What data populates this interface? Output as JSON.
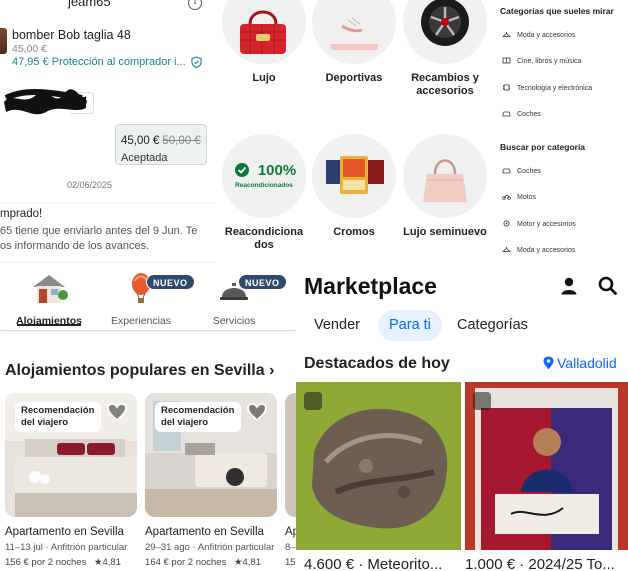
{
  "chat": {
    "username": "jeam65",
    "item_title": "bomber Bob taglia 48",
    "item_price": "45,00 €",
    "protection": "47,95 € Protección al comprador i...",
    "bubble_fragment": "5",
    "offer_new_price": "45,00 €",
    "offer_old_price": "50,00 €",
    "offer_status": "Aceptada",
    "date": "02/06/2025",
    "system_title": "mprado!",
    "system_line1": "65 tiene que enviarlo antes del 9 Jun. Te",
    "system_line2": "os informando de los avances."
  },
  "categories_grid": [
    {
      "label": "Lujo"
    },
    {
      "label": "Deportivas"
    },
    {
      "label": "Recambios y accesorios"
    },
    {
      "label": "Reacondiciona dos",
      "image_text": "100%",
      "image_subtext": "Reacondicionados"
    },
    {
      "label": "Cromos"
    },
    {
      "label": "Lujo seminuevo"
    }
  ],
  "category_list": {
    "usual_heading": "Categorías que sueles mirar",
    "usual_items": [
      {
        "label": "Moda y accesorios",
        "icon": "hanger-icon"
      },
      {
        "label": "Cine, libros y música",
        "icon": "book-icon"
      },
      {
        "label": "Tecnología y electrónica",
        "icon": "chip-icon"
      },
      {
        "label": "Coches",
        "icon": "car-icon"
      }
    ],
    "search_heading": "Buscar por categoría",
    "search_items": [
      {
        "label": "Coches",
        "icon": "car-icon"
      },
      {
        "label": "Motos",
        "icon": "motorbike-icon"
      },
      {
        "label": "Motor y accesorios",
        "icon": "gear-icon"
      },
      {
        "label": "Moda y accesorios",
        "icon": "hanger-icon"
      }
    ]
  },
  "airbnb": {
    "tabs": [
      {
        "label": "Alojamientos",
        "badge": ""
      },
      {
        "label": "Experiencias",
        "badge": "NUEVO"
      },
      {
        "label": "Servicios",
        "badge": "NUEVO"
      }
    ],
    "section_title": "Alojamientos populares en Sevilla",
    "chevron": "›",
    "cards": [
      {
        "guest_fav": "Recomendación del viajero",
        "name": "Apartamento en Sevilla",
        "dates_host": "11–13 jul · Anfitrión particular",
        "price": "156 € por 2 noches",
        "rating": "★4,81"
      },
      {
        "guest_fav": "Recomendación del viajero",
        "name": "Apartamento en Sevilla",
        "dates_host": "29–31 ago · Anfitrión particular",
        "price": "164 € por 2 noches",
        "rating": "★4,81"
      },
      {
        "guest_fav": "",
        "name": "Ap",
        "dates_host": "8–",
        "price": "15",
        "rating": ""
      }
    ]
  },
  "marketplace": {
    "title": "Marketplace",
    "tabs": [
      {
        "label": "Vender",
        "active": false
      },
      {
        "label": "Para ti",
        "active": true
      },
      {
        "label": "Categorías",
        "active": false
      }
    ],
    "today_heading": "Destacados de hoy",
    "location": "Valladolid",
    "products": [
      {
        "text": "4.600 € · Meteorito..."
      },
      {
        "text": "1.000 € · 2024/25 To..."
      }
    ],
    "accent_color": "#0866ff"
  }
}
